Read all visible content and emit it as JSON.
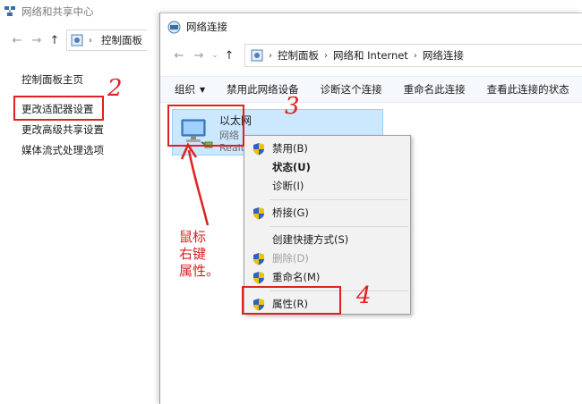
{
  "background_window": {
    "title": "网络和共享中心",
    "address_crumb": "控制面板",
    "left_links": [
      "控制面板主页",
      "更改适配器设置",
      "更改高级共享设置",
      "媒体流式处理选项"
    ]
  },
  "foreground_window": {
    "title": "网络连接",
    "breadcrumbs": [
      "控制面板",
      "网络和 Internet",
      "网络连接"
    ],
    "toolbar": {
      "organize": "组织",
      "disable_device": "禁用此网络设备",
      "diagnose": "诊断这个连接",
      "rename": "重命名此连接",
      "view_status": "查看此连接的状态"
    }
  },
  "adapter": {
    "name": "以太网",
    "type": "网络",
    "driver": "Realt"
  },
  "context_menu": {
    "items": [
      {
        "label": "禁用(B)",
        "shield": true,
        "bold": false,
        "disabled": false
      },
      {
        "label": "状态(U)",
        "shield": false,
        "bold": true,
        "disabled": false
      },
      {
        "label": "诊断(I)",
        "shield": false,
        "bold": false,
        "disabled": false
      },
      {
        "label": "桥接(G)",
        "shield": true,
        "bold": false,
        "disabled": false
      },
      {
        "label": "创建快捷方式(S)",
        "shield": false,
        "bold": false,
        "disabled": false
      },
      {
        "label": "删除(D)",
        "shield": true,
        "bold": false,
        "disabled": true
      },
      {
        "label": "重命名(M)",
        "shield": true,
        "bold": false,
        "disabled": false
      },
      {
        "label": "属性(R)",
        "shield": true,
        "bold": false,
        "disabled": false
      }
    ]
  },
  "annotations": {
    "step2": "2",
    "step3": "3",
    "step4": "4",
    "note": "鼠标\n右键\n属性。"
  },
  "colors": {
    "annotation_red": "#e02020",
    "selection_blue": "#cce8ff",
    "menu_bg": "#f2f2f2"
  }
}
